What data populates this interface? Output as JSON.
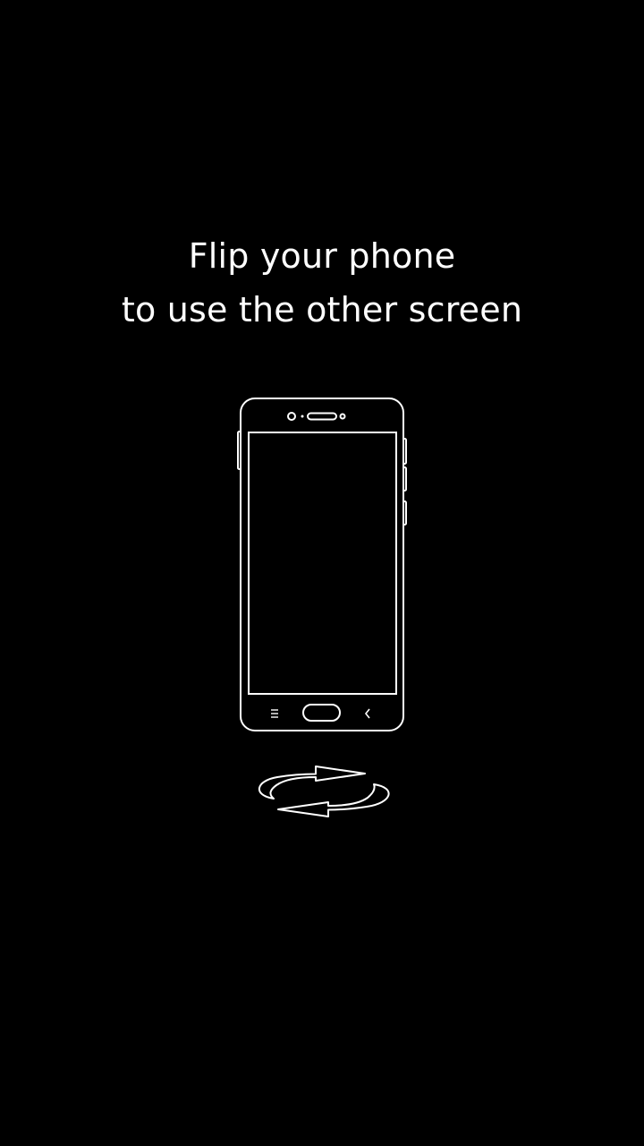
{
  "screen": {
    "background_color": "#000000",
    "foreground_color": "#ffffff"
  },
  "message": {
    "line1": "Flip your phone",
    "line2": "to use the other screen"
  },
  "illustration": {
    "phone_icon": "smartphone-outline-icon",
    "nav_icons": [
      "menu-icon",
      "home-button-icon",
      "back-chevron-icon"
    ],
    "flip_icon": "rotate-arrows-icon"
  }
}
